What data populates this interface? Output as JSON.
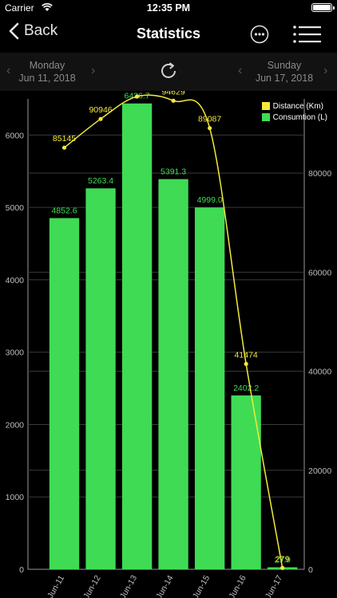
{
  "status": {
    "carrier": "Carrier",
    "time": "12:35 PM"
  },
  "nav": {
    "back_label": "Back",
    "title": "Statistics"
  },
  "dates": {
    "start_day": "Monday",
    "start_date": "Jun 11, 2018",
    "end_day": "Sunday",
    "end_date": "Jun 17, 2018"
  },
  "colors": {
    "consumption": "#3fdb55",
    "distance": "#f2ea3a",
    "background": "#000000",
    "grid": "#3a3a3a"
  },
  "icons": [
    "chevron-left-icon",
    "more-icon",
    "menu-icon",
    "refresh-icon",
    "wifi-icon",
    "battery-icon"
  ],
  "chart_data": {
    "type": "bar",
    "categories": [
      "Jun-11",
      "Jun-12",
      "Jun-13",
      "Jun-14",
      "Jun-15",
      "Jun-16",
      "Jun-17"
    ],
    "series": [
      {
        "name": "Consumtion (L)",
        "type": "bar",
        "axis": "left",
        "values": [
          4852.6,
          5263.4,
          6436.7,
          5391.3,
          4999.0,
          2402.2,
          27.9
        ],
        "labels": [
          "4852.6",
          "5263.4",
          "6436.7",
          "5391.3",
          "4999.0",
          "2402.2",
          "27.9"
        ]
      },
      {
        "name": "Distance (Km)",
        "type": "line",
        "axis": "right",
        "values": [
          85145,
          90946,
          95487,
          94629,
          89087,
          41474,
          279
        ],
        "labels": [
          "85145",
          "90946",
          "95487",
          "94629",
          "89087",
          "41474",
          "279"
        ]
      }
    ],
    "y_left": {
      "min": 0,
      "max": 6500,
      "ticks": [
        "0",
        "1000",
        "2000",
        "3000",
        "4000",
        "5000",
        "6000"
      ]
    },
    "y_right": {
      "min": 0,
      "max": 95000,
      "ticks": [
        "0",
        "20000",
        "40000",
        "60000",
        "80000"
      ]
    },
    "legend": "top-right",
    "grid": true
  }
}
